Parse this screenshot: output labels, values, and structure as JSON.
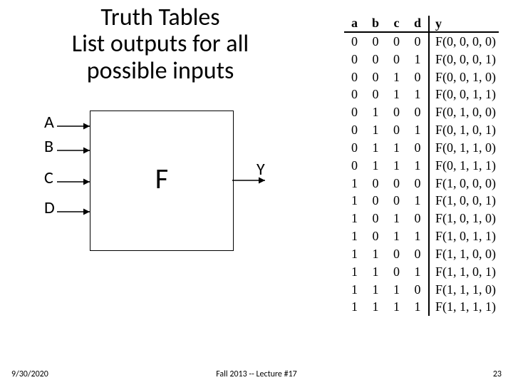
{
  "title_line1": "Truth Tables",
  "title_line2": "List outputs for all",
  "title_line3": "possible inputs",
  "inputs": {
    "a": "A",
    "b": "B",
    "c": "C",
    "d": "D"
  },
  "output_label": "Y",
  "block_label": "F",
  "chart_data": {
    "type": "table",
    "headers": [
      "a",
      "b",
      "c",
      "d",
      "y"
    ],
    "rows": [
      [
        "0",
        "0",
        "0",
        "0",
        "F(0, 0, 0, 0)"
      ],
      [
        "0",
        "0",
        "0",
        "1",
        "F(0, 0, 0, 1)"
      ],
      [
        "0",
        "0",
        "1",
        "0",
        "F(0, 0, 1, 0)"
      ],
      [
        "0",
        "0",
        "1",
        "1",
        "F(0, 0, 1, 1)"
      ],
      [
        "0",
        "1",
        "0",
        "0",
        "F(0, 1, 0, 0)"
      ],
      [
        "0",
        "1",
        "0",
        "1",
        "F(0, 1, 0, 1)"
      ],
      [
        "0",
        "1",
        "1",
        "0",
        "F(0, 1, 1, 0)"
      ],
      [
        "0",
        "1",
        "1",
        "1",
        "F(0, 1, 1, 1)"
      ],
      [
        "1",
        "0",
        "0",
        "0",
        "F(1, 0, 0, 0)"
      ],
      [
        "1",
        "0",
        "0",
        "1",
        "F(1, 0, 0, 1)"
      ],
      [
        "1",
        "0",
        "1",
        "0",
        "F(1, 0, 1, 0)"
      ],
      [
        "1",
        "0",
        "1",
        "1",
        "F(1, 0, 1, 1)"
      ],
      [
        "1",
        "1",
        "0",
        "0",
        "F(1, 1, 0, 0)"
      ],
      [
        "1",
        "1",
        "0",
        "1",
        "F(1, 1, 0, 1)"
      ],
      [
        "1",
        "1",
        "1",
        "0",
        "F(1, 1, 1, 0)"
      ],
      [
        "1",
        "1",
        "1",
        "1",
        "F(1, 1, 1, 1)"
      ]
    ]
  },
  "footer": {
    "date": "9/30/2020",
    "center": "Fall 2013 -- Lecture #17",
    "page": "23"
  }
}
